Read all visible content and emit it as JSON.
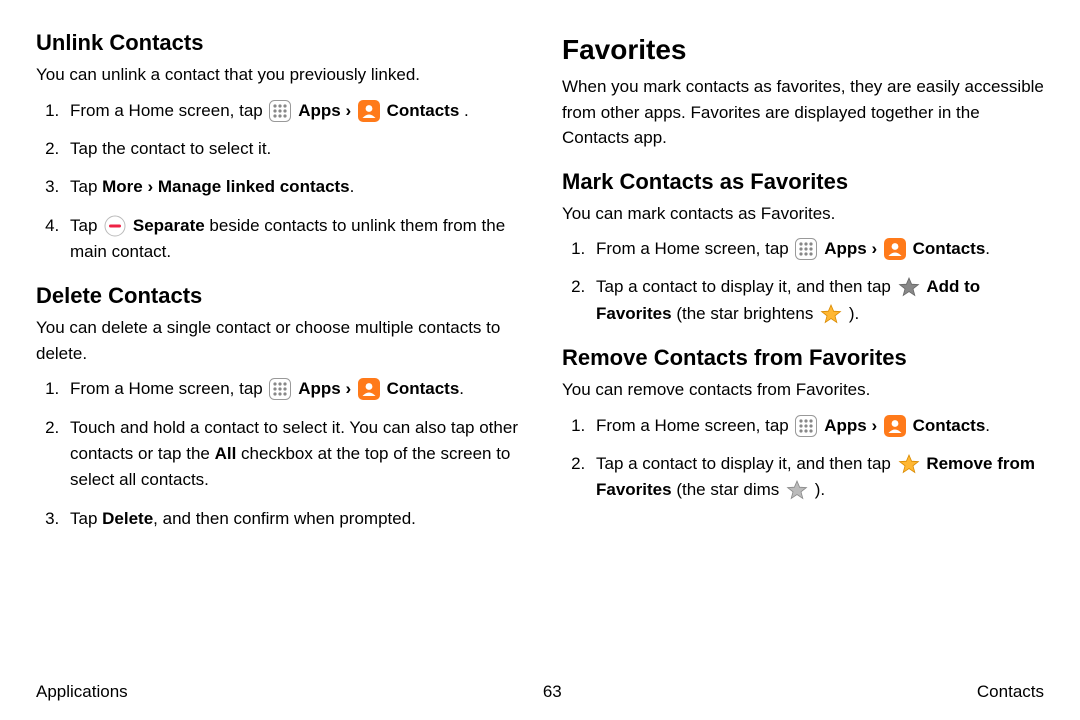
{
  "left": {
    "unlink": {
      "title": "Unlink Contacts",
      "intro": "You can unlink a contact that you previously linked.",
      "step1_a": "From a Home screen, tap ",
      "apps_label": "Apps",
      "contacts_label": "Contacts",
      "bracket": " › ",
      "period": " .",
      "step2": "Tap the contact to select it.",
      "step3_a": "Tap ",
      "step3_b": "More › Manage linked contacts",
      "step3_c": ".",
      "step4_a": "Tap ",
      "step4_b": "Separate",
      "step4_c": "  beside contacts to unlink them from the main contact."
    },
    "delete": {
      "title": "Delete Contacts",
      "intro": "You can delete a single contact or choose multiple contacts to delete.",
      "step1_a": "From a Home screen, tap ",
      "apps_label": "Apps",
      "contacts_label": "Contacts",
      "bracket": " › ",
      "step2_a": "Touch and hold a contact to select it. You can also tap other contacts or tap the ",
      "step2_b": "All",
      "step2_c": " checkbox at the top of the screen to select all contacts.",
      "step3_a": "Tap ",
      "step3_b": "Delete",
      "step3_c": ", and then confirm when prompted."
    }
  },
  "right": {
    "favorites": {
      "title": "Favorites",
      "intro": "When you mark contacts as favorites, they are easily accessible from other apps. Favorites are displayed together in the Contacts app."
    },
    "mark": {
      "title": "Mark Contacts as Favorites",
      "intro": "You can mark contacts as Favorites.",
      "step1_a": "From a Home screen, tap ",
      "apps_label": "Apps",
      "contacts_label": "Contacts",
      "bracket": " › ",
      "step2_a": "Tap a contact to display it, and then tap ",
      "step2_b": "Add to Favorites",
      "step2_c": " (the star brightens ",
      "step2_d": ")."
    },
    "remove": {
      "title": "Remove Contacts from Favorites",
      "intro": "You can remove contacts from Favorites.",
      "step1_a": "From a Home screen, tap ",
      "apps_label": "Apps",
      "contacts_label": "Contacts",
      "bracket": " › ",
      "step2_a": "Tap a contact to display it, and then tap ",
      "step2_b": "Remove from Favorites",
      "step2_c": " (the star dims ",
      "step2_d": ")."
    }
  },
  "footer": {
    "left": "Applications",
    "center": "63",
    "right": "Contacts"
  }
}
